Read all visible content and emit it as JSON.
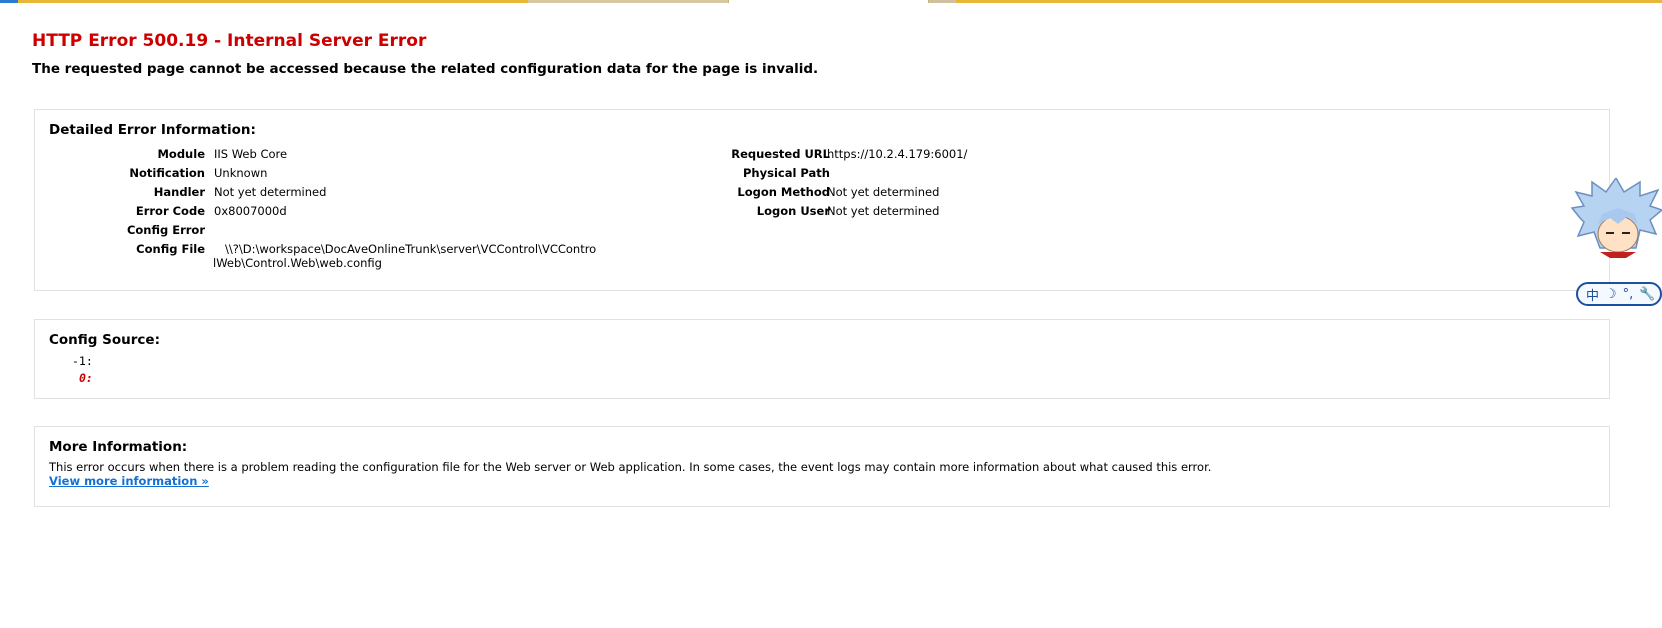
{
  "page": {
    "title": "HTTP Error 500.19 - Internal Server Error",
    "subtitle": "The requested page cannot be accessed because the related configuration data for the page is invalid."
  },
  "detailed": {
    "heading": "Detailed Error Information:",
    "left": [
      {
        "label": "Module",
        "value": "IIS Web Core"
      },
      {
        "label": "Notification",
        "value": "Unknown"
      },
      {
        "label": "Handler",
        "value": "Not yet determined"
      },
      {
        "label": "Error Code",
        "value": "0x8007000d"
      },
      {
        "label": "Config Error",
        "value": ""
      },
      {
        "label": "Config File",
        "value": "\\\\?\\D:\\workspace\\DocAveOnlineTrunk\\server\\VCControl\\VCControlWeb\\Control.Web\\web.config"
      }
    ],
    "right": [
      {
        "label": "Requested URL",
        "value": "https://10.2.4.179:6001/"
      },
      {
        "label": "Physical Path",
        "value": ""
      },
      {
        "label": "Logon Method",
        "value": "Not yet determined"
      },
      {
        "label": "Logon User",
        "value": "Not yet determined"
      }
    ]
  },
  "config_source": {
    "heading": "Config Source:",
    "lines": [
      "-1:",
      "0:"
    ]
  },
  "more_info": {
    "heading": "More Information:",
    "text": "This error occurs when there is a problem reading the configuration file for the Web server or Web application. In some cases, the event logs may contain more information about what caused this error.",
    "link_label": "View more information »"
  },
  "ime": {
    "chars": [
      "中",
      "☽",
      "°,",
      "🔧"
    ]
  },
  "colors": {
    "error_red": "#cc0000",
    "link_blue": "#1570d6",
    "box_border": "#e2e2e2"
  }
}
